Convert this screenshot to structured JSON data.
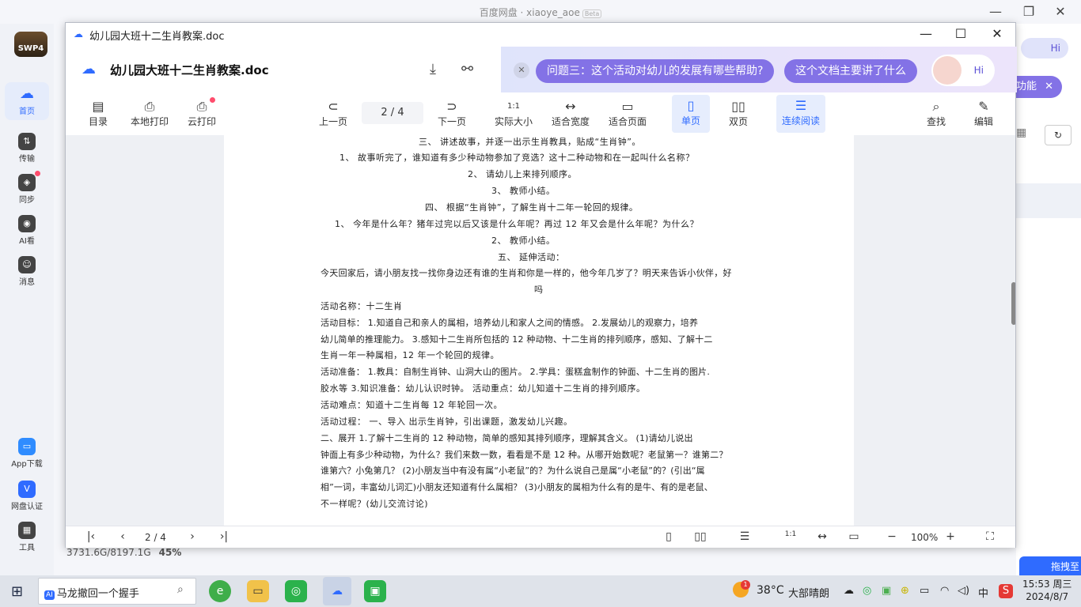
{
  "app": {
    "title": "百度网盘 · xiaoye_aoe",
    "beta": "Beta",
    "min": "—",
    "max": "❐",
    "close": "✕"
  },
  "sidebar": {
    "logo": "SWP4",
    "items": [
      {
        "label": "首页",
        "icon": "☁"
      },
      {
        "label": "传输",
        "icon": "⇅"
      },
      {
        "label": "同步",
        "icon": "◈"
      },
      {
        "label": "AI看",
        "icon": "◉"
      },
      {
        "label": "消息",
        "icon": "☺"
      }
    ],
    "bottom": [
      {
        "label": "App下载",
        "icon": "▭"
      },
      {
        "label": "网盘认证",
        "icon": "V"
      },
      {
        "label": "工具",
        "icon": "▦"
      }
    ]
  },
  "storage": {
    "used": "3731.6G/8197.1G",
    "percent": "45%"
  },
  "bg_right": {
    "hi": "Hi",
    "feature": "功能",
    "promo": "拖拽至"
  },
  "viewer": {
    "window_title": "幼儿园大班十二生肖教案.doc",
    "doc_name": "幼儿园大班十二生肖教案.doc",
    "ai": {
      "close": "✕",
      "q1": "问题三：这个活动对幼儿的发展有哪些帮助?",
      "q2": "这个文档主要讲了什么",
      "hi": "Hi"
    },
    "toolbar": {
      "catalog": "目录",
      "local_print": "本地打印",
      "cloud_print": "云打印",
      "prev": "上一页",
      "page": "2  / 4",
      "next": "下一页",
      "actual_size": "实际大小",
      "fit_width": "适合宽度",
      "fit_page": "适合页面",
      "single": "单页",
      "double": "双页",
      "continuous": "连续阅读",
      "find": "查找",
      "edit": "编辑"
    },
    "doc_lines": [
      "三、      讲述故事，并逐一出示生肖教具，贴成“生肖钟”。",
      "1、          故事听完了，谁知道有多少种动物参加了竞选？这十二种动物和在一起叫什么名称？",
      "2、          请幼儿上来排列顺序。",
      "3、          教师小结。",
      "四、     根据“生肖钟”，了解生肖十二年一轮回的规律。",
      "1、          今年是什么年？猪年过完以后又该是什么年呢？再过 12 年又会是什么年呢？为什么？",
      "2、          教师小结。",
      "五、      延伸活动：",
      "今天回家后，请小朋友找一找你身边还有谁的生肖和你是一样的，他今年几岁了？明天来告诉小伙伴，好",
      "吗",
      "活动名称：十二生肖",
      "活动目标：      1.知道自己和亲人的属相，培养幼儿和家人之间的情感。      2.发展幼儿的观察力，培养",
      "幼儿简单的推理能力。      3.感知十二生肖所包括的 12 种动物、十二生肖的排列顺序，感知、了解十二",
      "生肖一年一种属相，12 年一个轮回的规律。",
      "活动准备：      1.教具：自制生肖钟、山洞大山的图片。      2.学具：蛋糕盒制作的钟面、十二生肖的图片.",
      "胶水等      3.知识准备：幼儿认识时钟。      活动重点：幼儿知道十二生肖的排列顺序。",
      "活动难点：知道十二生肖每 12 年轮回一次。",
      "活动过程：       一、导入       出示生肖钟，引出课题，激发幼儿兴趣。",
      "二、展开      1.了解十二生肖的 12 种动物，简单的感知其排列顺序，理解其含义。      (1)请幼儿说出",
      "钟面上有多少种动物，为什么？我们来数一数，看看是不是 12 种。从哪开始数呢？老鼠第一？谁第二？",
      "谁第六？小兔第几？      (2)小朋友当中有没有属“小老鼠”的？为什么说自己是属“小老鼠”的？(引出“属",
      "相”一词，丰富幼儿词汇)小朋友还知道有什么属相？      (3)小朋友的属相为什么有的是牛、有的是老鼠、",
      "不一样呢？(幼儿交流讨论)"
    ],
    "footer": {
      "first": "|‹",
      "prev": "‹",
      "page": "2  / 4",
      "next": "›",
      "last": "›|",
      "zoom": "100%",
      "minus": "−",
      "plus": "+"
    }
  },
  "taskbar": {
    "search": "马龙撤回一个握手",
    "search_ai": "AI",
    "weather_temp": "38°C",
    "weather_desc": "大部晴朗",
    "weather_badge": "1",
    "ime": "中",
    "time": "15:53 周三",
    "date": "2024/8/7"
  }
}
